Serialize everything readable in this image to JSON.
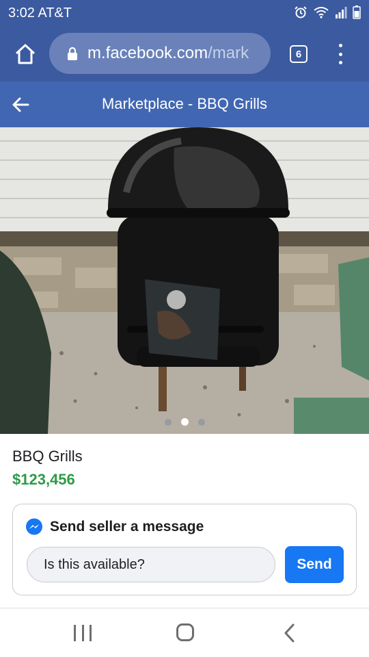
{
  "status_bar": {
    "time": "3:02",
    "carrier": "AT&T",
    "icons": [
      "alarm-icon",
      "wifi-icon",
      "signal-icon",
      "battery-icon"
    ]
  },
  "browser": {
    "url_host": "m.facebook.com",
    "url_path": "/mark",
    "tab_count": "6",
    "toolbar_color": "#3b5aa0",
    "url_pill_color": "#6a82b9"
  },
  "header": {
    "title": "Marketplace - BBQ Grills",
    "color": "#4267b2"
  },
  "photo": {
    "subject": "black bullet smoker grill",
    "slide_count": 3,
    "active_slide": 2
  },
  "listing": {
    "title": "BBQ Grills",
    "price": "$123,456",
    "price_color": "#2e9a47"
  },
  "message_card": {
    "heading": "Send seller a message",
    "input_value": "Is this available?",
    "send_label": "Send",
    "send_color": "#1877f2"
  },
  "nav_bar": {
    "icons": [
      "recent-apps-icon",
      "home-icon",
      "back-icon"
    ]
  }
}
